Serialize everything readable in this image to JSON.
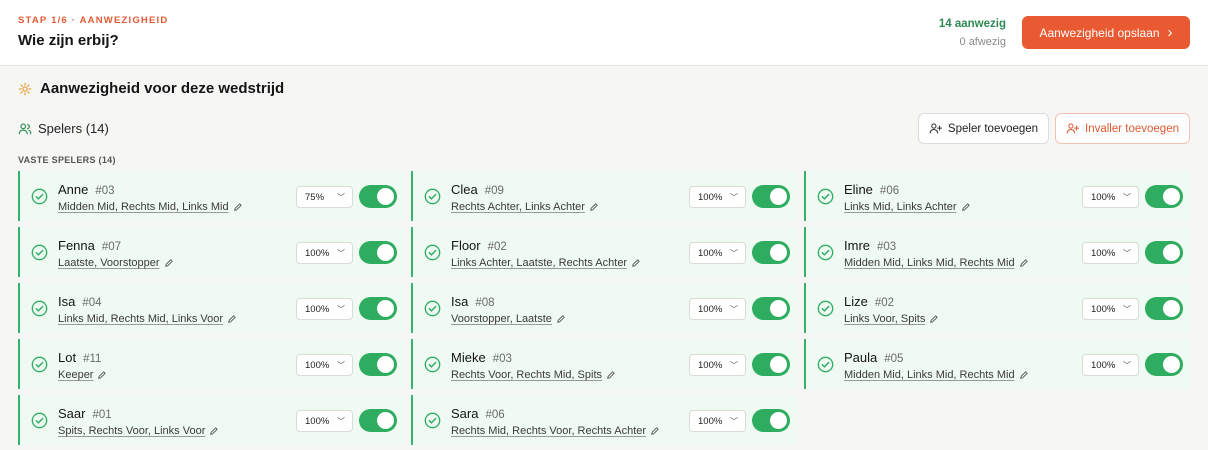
{
  "header": {
    "step": "STAP 1/6 · AANWEZIGHEID",
    "title": "Wie zijn erbij?",
    "present": "14 aanwezig",
    "absent": "0 afwezig",
    "save_label": "Aanwezigheid opslaan",
    "accent": "#ea5a32"
  },
  "section": {
    "title": "Aanwezigheid voor deze wedstrijd",
    "players_label": "Spelers (14)",
    "add_player_label": "Speler toevoegen",
    "add_sub_label": "Invaller toevoegen",
    "group_label": "VASTE SPELERS (14)"
  },
  "icons": {
    "section": "gear-icon",
    "players": "users-icon",
    "add": "user-plus-icon",
    "status": "check-circle-icon",
    "edit": "pencil-icon",
    "save": "chevron-right-icon"
  },
  "players": [
    {
      "name": "Anne",
      "number": "#03",
      "positions": "Midden Mid, Rechts Mid, Links Mid",
      "availability": "75%",
      "present": true
    },
    {
      "name": "Clea",
      "number": "#09",
      "positions": "Rechts Achter, Links Achter",
      "availability": "100%",
      "present": true
    },
    {
      "name": "Eline",
      "number": "#06",
      "positions": "Links Mid, Links Achter",
      "availability": "100%",
      "present": true
    },
    {
      "name": "Fenna",
      "number": "#07",
      "positions": "Laatste, Voorstopper",
      "availability": "100%",
      "present": true
    },
    {
      "name": "Floor",
      "number": "#02",
      "positions": "Links Achter, Laatste, Rechts Achter",
      "availability": "100%",
      "present": true
    },
    {
      "name": "Imre",
      "number": "#03",
      "positions": "Midden Mid, Links Mid, Rechts Mid",
      "availability": "100%",
      "present": true
    },
    {
      "name": "Isa",
      "number": "#04",
      "positions": "Links Mid, Rechts Mid, Links Voor",
      "availability": "100%",
      "present": true
    },
    {
      "name": "Isa",
      "number": "#08",
      "positions": "Voorstopper, Laatste",
      "availability": "100%",
      "present": true
    },
    {
      "name": "Lize",
      "number": "#02",
      "positions": "Links Voor, Spits",
      "availability": "100%",
      "present": true
    },
    {
      "name": "Lot",
      "number": "#11",
      "positions": "Keeper",
      "availability": "100%",
      "present": true
    },
    {
      "name": "Mieke",
      "number": "#03",
      "positions": "Rechts Voor, Rechts Mid, Spits",
      "availability": "100%",
      "present": true
    },
    {
      "name": "Paula",
      "number": "#05",
      "positions": "Midden Mid, Links Mid, Rechts Mid",
      "availability": "100%",
      "present": true
    },
    {
      "name": "Saar",
      "number": "#01",
      "positions": "Spits, Rechts Voor, Links Voor",
      "availability": "100%",
      "present": true
    },
    {
      "name": "Sara",
      "number": "#06",
      "positions": "Rechts Mid, Rechts Voor, Rechts Achter",
      "availability": "100%",
      "present": true
    }
  ]
}
